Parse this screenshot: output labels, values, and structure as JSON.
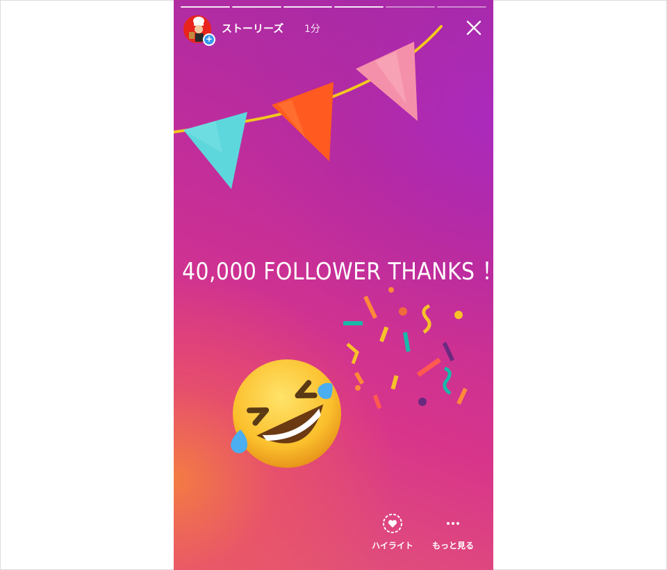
{
  "story": {
    "segments": [
      true,
      true,
      true,
      true,
      false,
      false
    ],
    "user": {
      "name": "ストーリーズ",
      "time": "1分"
    },
    "caption": "40,000 FOLLOWER THANKS ！",
    "colors": {
      "gradient_top": "#a42aa8",
      "gradient_mid": "#c12d9b",
      "gradient_bottom": "#e45a73",
      "avatar_bg": "#e8241c",
      "add_badge": "#3897f0"
    },
    "stickers": [
      "party-bunting",
      "rolling-on-floor-laughing-emoji",
      "confetti"
    ]
  },
  "actions": {
    "highlight": {
      "label": "ハイライト",
      "icon": "heart-circle-icon"
    },
    "more": {
      "label": "もっと見る",
      "icon": "more-dots-icon"
    }
  }
}
